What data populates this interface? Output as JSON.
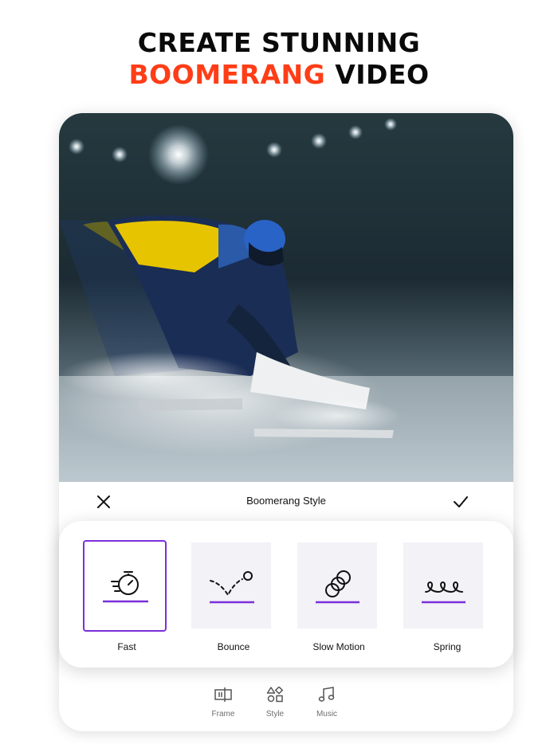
{
  "headline": {
    "line1": "CREATE STUNNING",
    "accent": "BOOMERANG",
    "rest": " VIDEO"
  },
  "toolbar": {
    "title": "Boomerang Style",
    "close_icon": "close-icon",
    "confirm_icon": "checkmark-icon"
  },
  "styles": [
    {
      "label": "Fast",
      "icon": "stopwatch-icon",
      "selected": true
    },
    {
      "label": "Bounce",
      "icon": "bounce-icon",
      "selected": false
    },
    {
      "label": "Slow Motion",
      "icon": "slow-motion-icon",
      "selected": false
    },
    {
      "label": "Spring",
      "icon": "spring-icon",
      "selected": false
    }
  ],
  "bottom_nav": [
    {
      "label": "Frame",
      "icon": "frame-icon"
    },
    {
      "label": "Style",
      "icon": "shapes-icon"
    },
    {
      "label": "Music",
      "icon": "music-note-icon"
    }
  ],
  "colors": {
    "accent": "#ff3d17",
    "selection": "#7b2fdb"
  }
}
